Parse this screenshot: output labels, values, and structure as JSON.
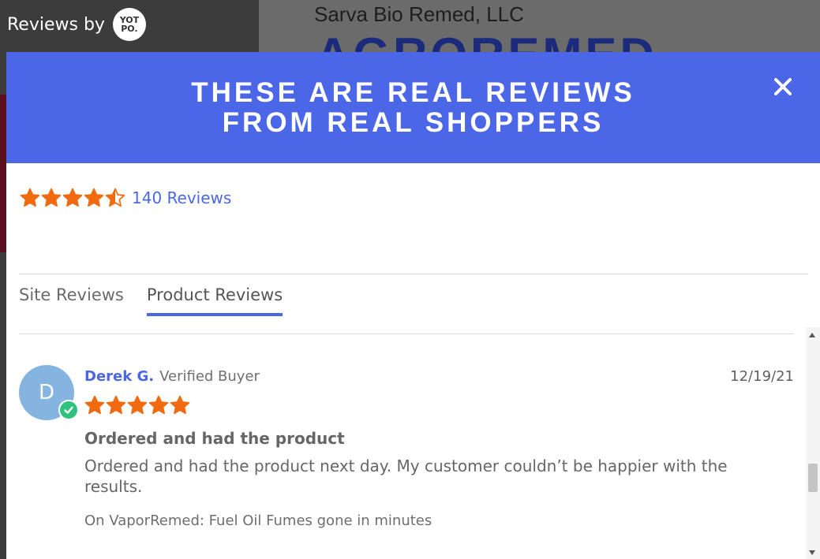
{
  "backdrop": {
    "reviews_by": "Reviews by",
    "yotpo_logo": "YOT PO.",
    "company_name": "Sarva Bio Remed, LLC",
    "brand_partial": "AGROREMED"
  },
  "modal": {
    "title_line1": "THESE ARE REAL REVIEWS",
    "title_line2": "FROM REAL SHOPPERS",
    "close_label": "×",
    "accent_color": "#4c66e8",
    "star_color": "#f26a10"
  },
  "summary": {
    "rating": 4.5,
    "stars_max": 5,
    "review_count_label": "140 Reviews"
  },
  "tabs": [
    {
      "label": "Site Reviews",
      "active": false
    },
    {
      "label": "Product Reviews",
      "active": true
    }
  ],
  "review": {
    "avatar_initial": "D",
    "name": "Derek G.",
    "badge": "Verified Buyer",
    "date": "12/19/21",
    "rating": 5,
    "title": "Ordered and had the product",
    "body": "Ordered and had the product next day. My customer couldn’t be happier with the results.",
    "product": "On VaporRemed: Fuel Oil Fumes gone in minutes"
  },
  "scrollbar": {
    "position_fraction": 0.6
  }
}
